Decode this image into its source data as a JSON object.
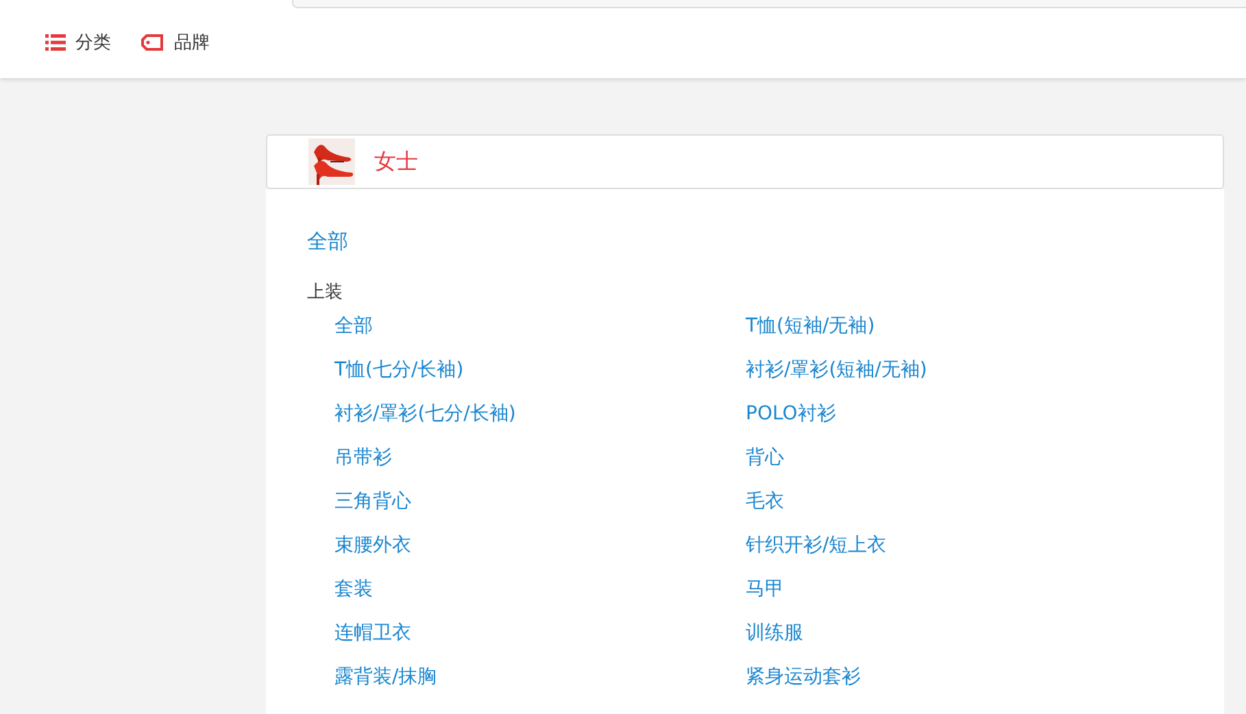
{
  "nav": [
    {
      "kind": "list",
      "label": "分类"
    },
    {
      "kind": "tag",
      "label": "品牌"
    }
  ],
  "category": {
    "title": "女士",
    "all_link": "全部",
    "groups": [
      {
        "title": "上装",
        "items": [
          "全部",
          "T恤(短袖/无袖)",
          "T恤(七分/长袖)",
          "衬衫/罩衫(短袖/无袖)",
          "衬衫/罩衫(七分/长袖)",
          "POLO衬衫",
          "吊带衫",
          "背心",
          "三角背心",
          "毛衣",
          "束腰外衣",
          "针织开衫/短上衣",
          "套装",
          "马甲",
          "连帽卫衣",
          "训练服",
          "露背装/抹胸",
          "紧身运动套衫"
        ]
      }
    ]
  }
}
